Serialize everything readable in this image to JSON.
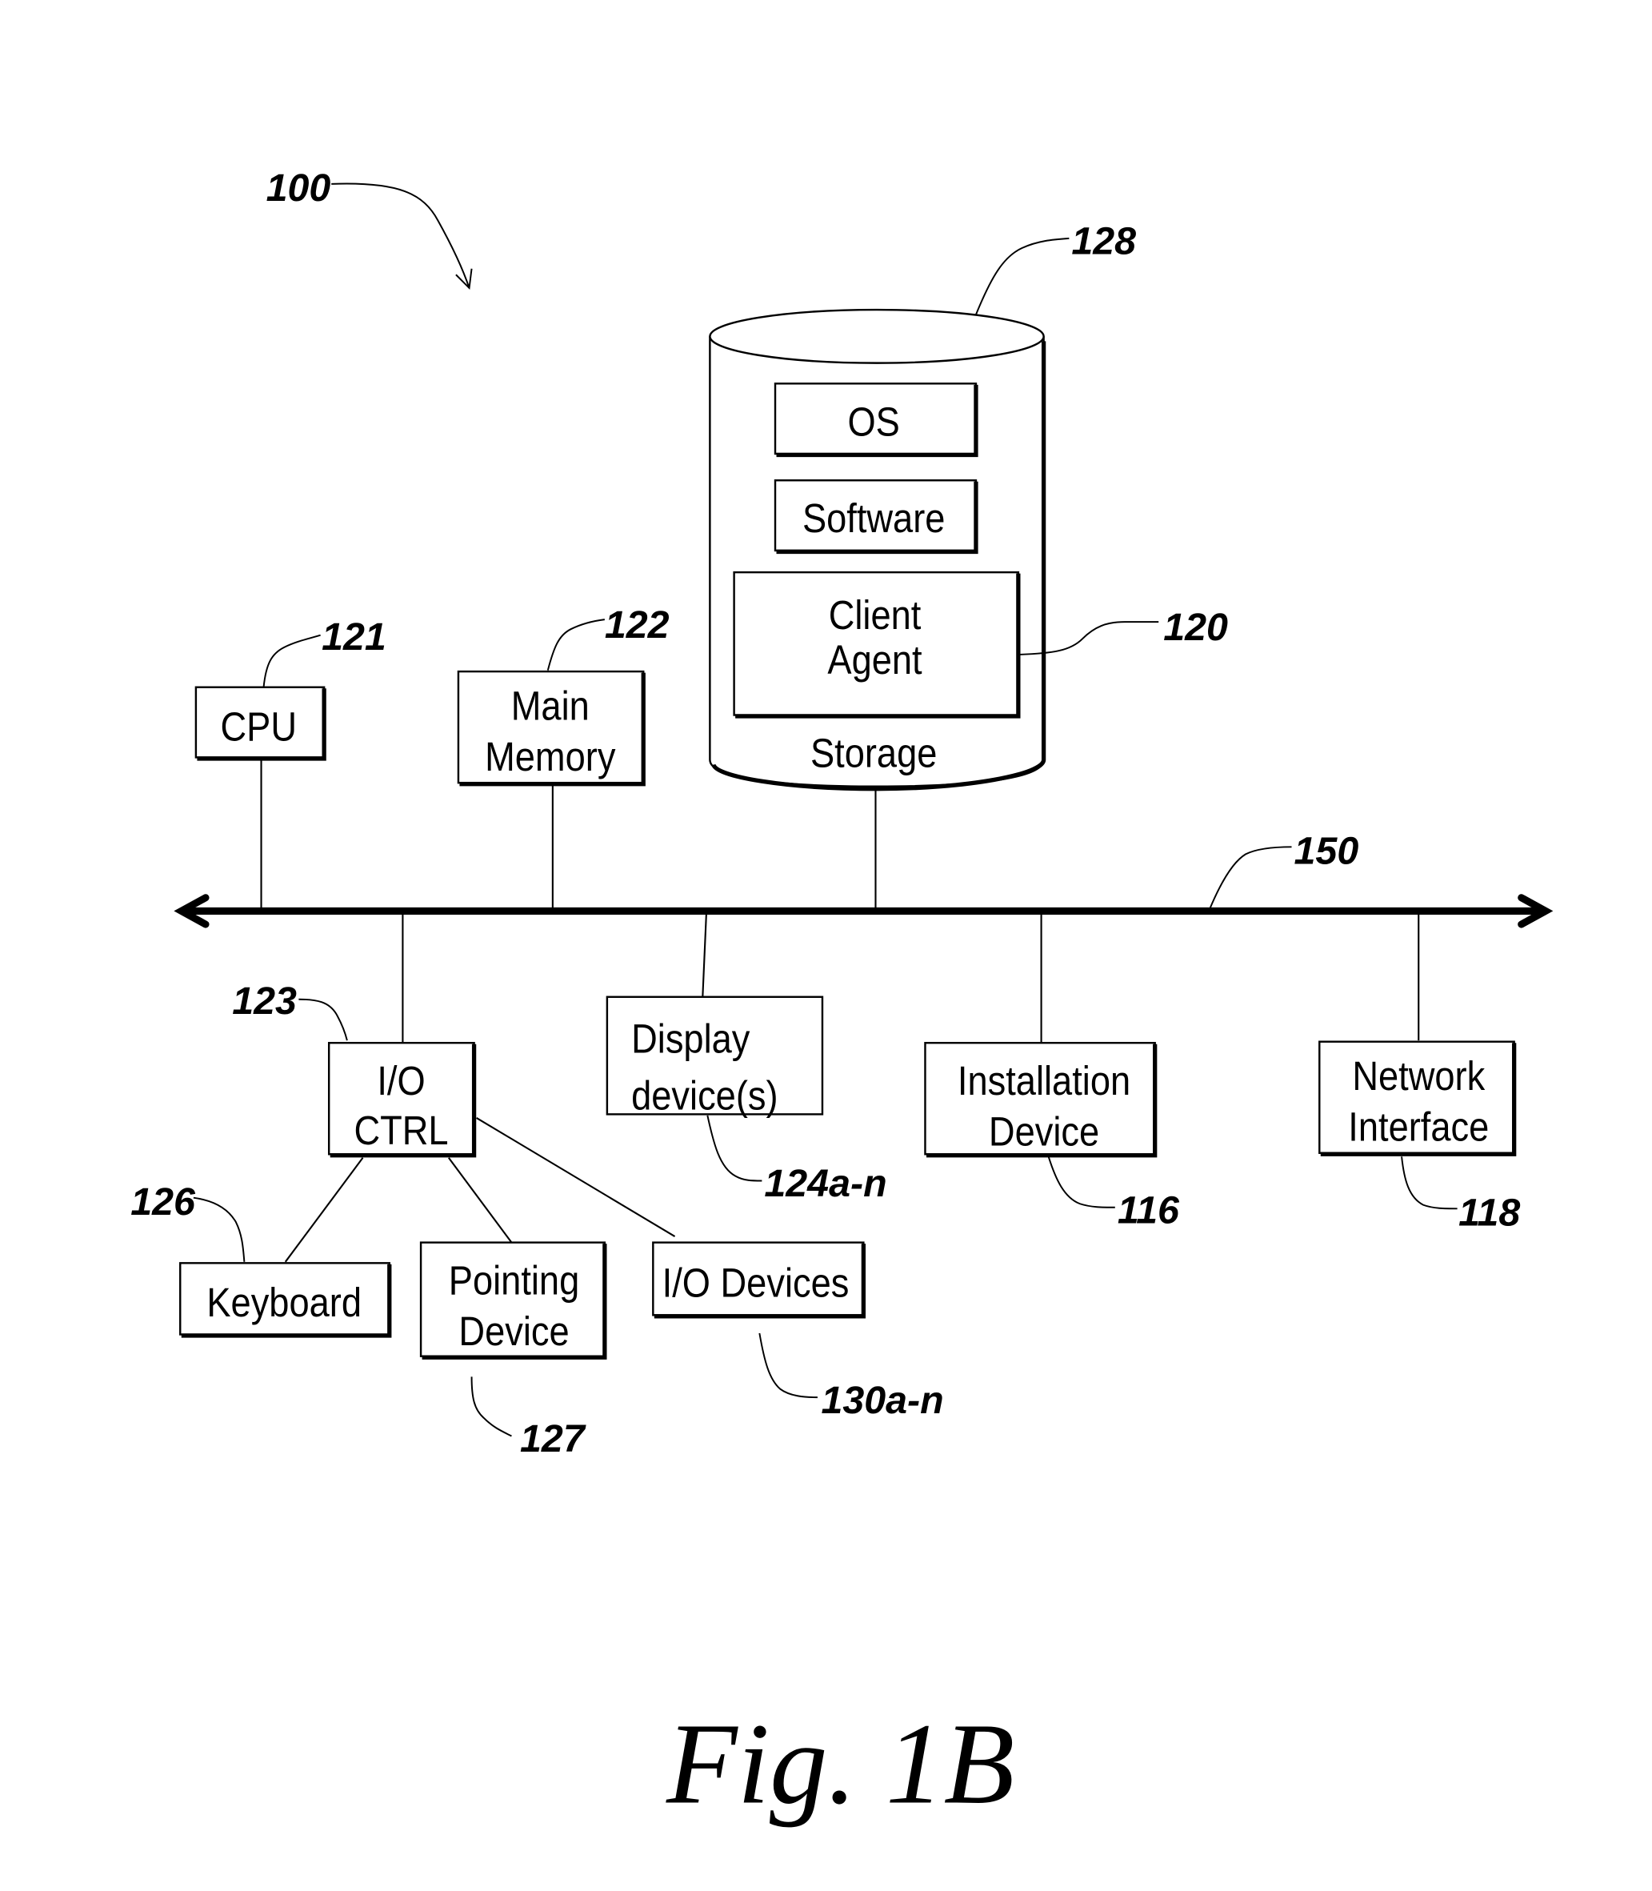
{
  "figure": {
    "caption": "Fig. 1B",
    "system_ref": "100",
    "bus": {
      "ref": "150"
    },
    "storage": {
      "ref": "128",
      "label": "Storage",
      "os_label": "OS",
      "software_label": "Software",
      "client_agent_line1": "Client",
      "client_agent_line2": "Agent",
      "client_agent_ref": "120"
    },
    "cpu": {
      "label": "CPU",
      "ref": "121"
    },
    "main_memory": {
      "line1": "Main",
      "line2": "Memory",
      "ref": "122"
    },
    "io_ctrl": {
      "line1": "I/O",
      "line2": "CTRL",
      "ref": "123"
    },
    "display": {
      "line1": "Display",
      "line2": "device(s)",
      "ref": "124a-n"
    },
    "installation": {
      "line1": "Installation",
      "line2": "Device",
      "ref": "116"
    },
    "network": {
      "line1": "Network",
      "line2": "Interface",
      "ref": "118"
    },
    "keyboard": {
      "label": "Keyboard",
      "ref": "126"
    },
    "pointing": {
      "line1": "Pointing",
      "line2": "Device",
      "ref": "127"
    },
    "io_devices": {
      "label": "I/O Devices",
      "ref": "130a-n"
    }
  }
}
